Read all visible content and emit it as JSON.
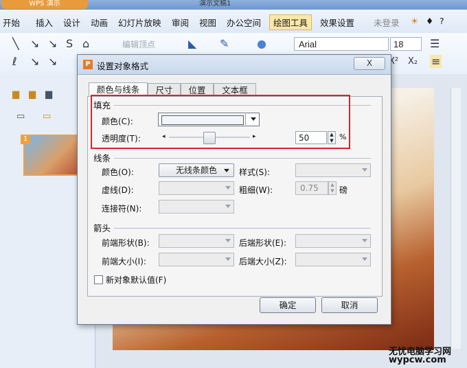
{
  "app": {
    "wps_button": "WPS 演示",
    "doc_title": "演示文稿1"
  },
  "menu": [
    "开始",
    "插入",
    "设计",
    "动画",
    "幻灯片放映",
    "审阅",
    "视图",
    "办公空间",
    "绘图工具",
    "效果设置",
    "未登录"
  ],
  "menu_active": "绘图工具",
  "ribbon": {
    "edit_vertex": "编辑顶点",
    "font": "Arial",
    "font_size": "18"
  },
  "slide_number": "1",
  "dialog": {
    "title": "设置对象格式",
    "tabs": [
      "颜色与线条",
      "尺寸",
      "位置",
      "文本框"
    ],
    "fill": {
      "section": "填充",
      "color_label": "颜色(C):",
      "transparency_label": "透明度(T):",
      "transparency_value": "50",
      "percent": "%"
    },
    "line": {
      "section": "线条",
      "color_label": "颜色(O):",
      "color_value": "无线条颜色",
      "style_label": "样式(S):",
      "dash_label": "虚线(D):",
      "weight_label": "粗细(W):",
      "weight_value": "0.75",
      "weight_unit": "磅",
      "connector_label": "连接符(N):"
    },
    "arrows": {
      "section": "箭头",
      "begin_style": "前端形状(B):",
      "end_style": "后端形状(E):",
      "begin_size": "前端大小(I):",
      "end_size": "后端大小(Z):"
    },
    "default_checkbox": "新对象默认值(F)",
    "ok": "确定",
    "cancel": "取消",
    "close": "X"
  },
  "watermark": {
    "line1": "无忧电脑学习网",
    "line2": "wypcw.com"
  },
  "colors": {
    "highlight": "#d8242c",
    "ribbon": "#e8f0fa",
    "titlebar": "#7aa1d6",
    "wps": "#e99a3a"
  }
}
